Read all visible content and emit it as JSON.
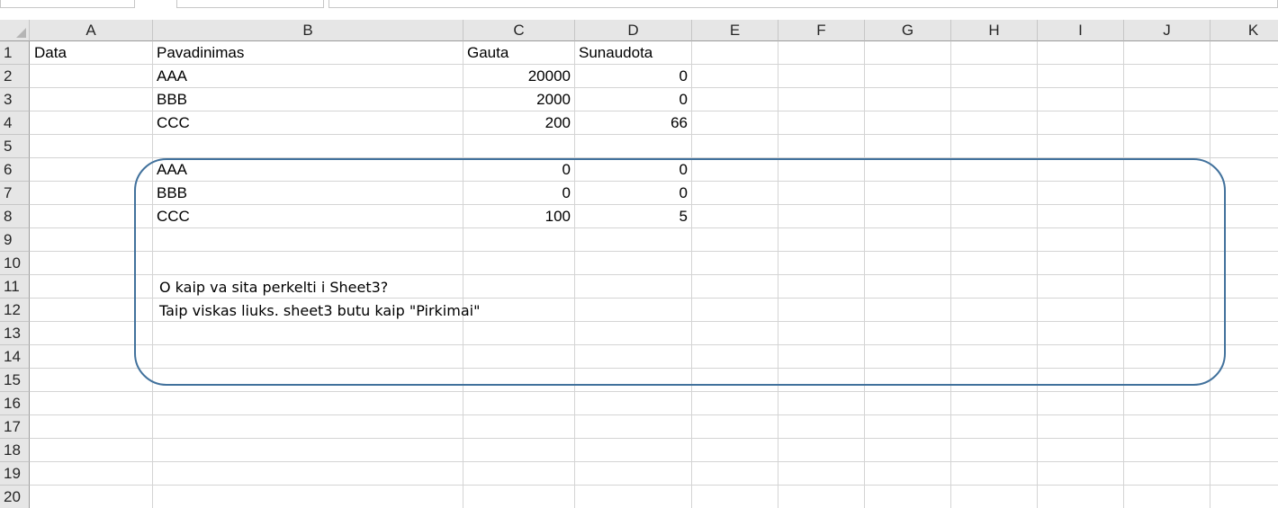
{
  "columns": [
    "A",
    "B",
    "C",
    "D",
    "E",
    "F",
    "G",
    "H",
    "I",
    "J",
    "K"
  ],
  "rows": [
    "1",
    "2",
    "3",
    "4",
    "5",
    "6",
    "7",
    "8",
    "9",
    "10",
    "11",
    "12",
    "13",
    "14",
    "15",
    "16",
    "17",
    "18",
    "19",
    "20"
  ],
  "cells": {
    "A1": "Data",
    "B1": "Pavadinimas",
    "C1": "Gauta",
    "D1": "Sunaudota",
    "B2": "AAA",
    "C2": "20000",
    "D2": "0",
    "B3": "BBB",
    "C3": "2000",
    "D3": "0",
    "B4": "CCC",
    "C4": "200",
    "D4": "66",
    "B6": "AAA",
    "C6": "0",
    "D6": "0",
    "B7": "BBB",
    "C7": "0",
    "D7": "0",
    "B8": "CCC",
    "C8": "100",
    "D8": "5"
  },
  "note": {
    "line1": "O kaip va sita perkelti i Sheet3?",
    "line2": "Taip viskas liuks. sheet3 butu kaip \"Pirkimai\""
  },
  "colors": {
    "header_bg": "#e6e6e6",
    "gridline": "#d4d4d4",
    "note_border": "#41719c"
  }
}
